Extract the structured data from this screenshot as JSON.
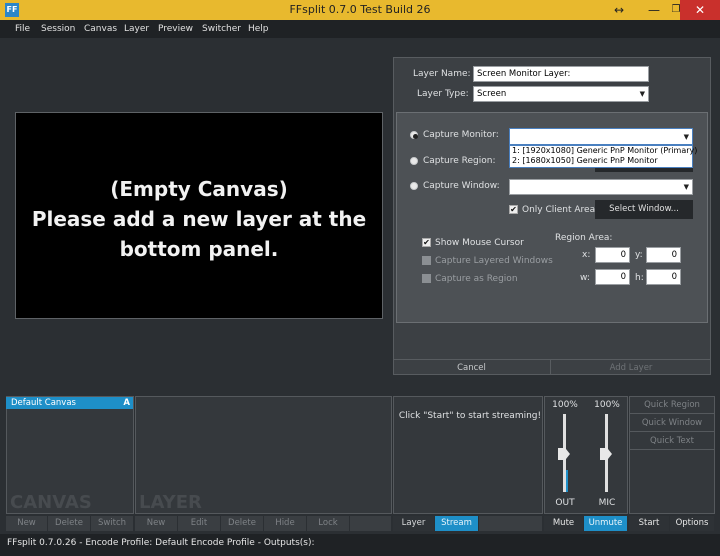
{
  "window": {
    "title": "FFsplit 0.7.0 Test Build 26",
    "icon_text": "FF",
    "resize_glyph": "↔",
    "minimize": "—",
    "restore": "❐",
    "close": "✕"
  },
  "menu": {
    "items": [
      "File",
      "Session",
      "Canvas",
      "Layer",
      "Preview",
      "Switcher",
      "Help"
    ]
  },
  "canvas": {
    "empty_text": "(Empty Canvas)\nPlease add a new layer at the bottom panel."
  },
  "layer_form": {
    "name_label": "Layer Name:",
    "name_value": "Screen Monitor Layer:",
    "type_label": "Layer Type:",
    "type_value": "Screen",
    "capture_monitor_label": "Capture Monitor:",
    "capture_monitor_value": "",
    "monitor_options": [
      "1: [1920x1080] Generic PnP Monitor (Primary)",
      "2: [1680x1050] Generic PnP Monitor"
    ],
    "capture_region_label": "Capture Region:",
    "capture_window_label": "Capture Window:",
    "capture_window_value": "",
    "only_client_area_label": "Only Client Area",
    "select_window_button": "Select Window...",
    "show_mouse_cursor_label": "Show Mouse Cursor",
    "capture_layered_windows_label": "Capture Layered Windows",
    "capture_as_region_label": "Capture as Region",
    "region_area_label": "Region Area:",
    "x_label": "x:",
    "x_value": "0",
    "y_label": "y:",
    "y_value": "0",
    "w_label": "w:",
    "w_value": "0",
    "h_label": "h:",
    "h_value": "0",
    "cancel_button": "Cancel",
    "add_layer_button": "Add Layer"
  },
  "canvas_panel": {
    "items": [
      {
        "label": "Default Canvas",
        "badge": "A"
      }
    ],
    "title": "CANVAS",
    "buttons": [
      "New",
      "Delete",
      "Switch"
    ]
  },
  "layer_panel": {
    "title": "LAYER",
    "buttons": [
      "New",
      "Edit",
      "Delete",
      "Hide",
      "Lock"
    ]
  },
  "stream_panel": {
    "message": "Click \"Start\" to start streaming!",
    "tabs": [
      "Layer",
      "Stream"
    ]
  },
  "audio": {
    "out_level": "100%",
    "mic_level": "100%",
    "out_label": "OUT",
    "mic_label": "MIC",
    "out_value": 1.0,
    "mic_value": 1.0,
    "mute_button": "Mute",
    "unmute_button": "Unmute"
  },
  "quick": {
    "buttons": [
      "Quick Region",
      "Quick Window",
      "Quick Text"
    ],
    "start_button": "Start",
    "options_button": "Options"
  },
  "status": {
    "text": "FFsplit 0.7.0.26 - Encode Profile: Default Encode Profile - Outputs(s):"
  },
  "colors": {
    "titlebar": "#e8b92e",
    "accent": "#1e8fc8",
    "close": "#c9302c"
  }
}
